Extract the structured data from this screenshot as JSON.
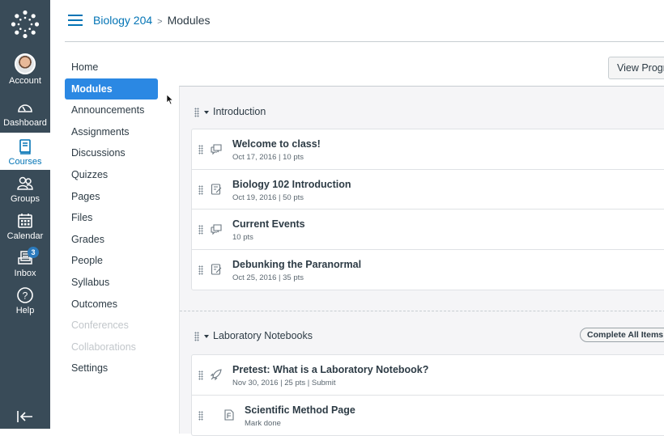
{
  "global_nav": {
    "items": [
      {
        "label": "Account",
        "icon": "avatar"
      },
      {
        "label": "Dashboard",
        "icon": "dashboard-icon"
      },
      {
        "label": "Courses",
        "icon": "courses-icon",
        "active": true
      },
      {
        "label": "Groups",
        "icon": "groups-icon"
      },
      {
        "label": "Calendar",
        "icon": "calendar-icon"
      },
      {
        "label": "Inbox",
        "icon": "inbox-icon",
        "badge": "3"
      },
      {
        "label": "Help",
        "icon": "help-icon"
      }
    ],
    "colors": {
      "background": "#394b58",
      "active_text": "#0374b5",
      "badge": "#2b7abc"
    }
  },
  "header": {
    "course": "Biology 204",
    "separator": ">",
    "page": "Modules"
  },
  "course_nav": {
    "items": [
      {
        "label": "Home"
      },
      {
        "label": "Modules",
        "active": true
      },
      {
        "label": "Announcements"
      },
      {
        "label": "Assignments"
      },
      {
        "label": "Discussions"
      },
      {
        "label": "Quizzes"
      },
      {
        "label": "Pages"
      },
      {
        "label": "Files"
      },
      {
        "label": "Grades"
      },
      {
        "label": "People"
      },
      {
        "label": "Syllabus"
      },
      {
        "label": "Outcomes"
      },
      {
        "label": "Conferences",
        "disabled": true
      },
      {
        "label": "Collaborations",
        "disabled": true
      },
      {
        "label": "Settings"
      }
    ],
    "active_color": "#2b88e3"
  },
  "toolbar": {
    "view_progress_label": "View Progress"
  },
  "modules": [
    {
      "title": "Introduction",
      "items": [
        {
          "title": "Welcome to class!",
          "meta": "Oct 17, 2016  |  10 pts",
          "icon": "discussion-icon"
        },
        {
          "title": "Biology 102 Introduction",
          "meta": "Oct 19, 2016  |  50 pts",
          "icon": "assignment-icon"
        },
        {
          "title": "Current Events",
          "meta": "10 pts",
          "icon": "discussion-icon"
        },
        {
          "title": "Debunking the Paranormal",
          "meta": "Oct 25, 2016  |  35 pts",
          "icon": "assignment-icon"
        }
      ]
    },
    {
      "title": "Laboratory Notebooks",
      "complete_all_label": "Complete All Items",
      "items": [
        {
          "title": "Pretest: What is a Laboratory Notebook?",
          "meta": "Nov 30, 2016  |  25 pts  |  Submit",
          "icon": "quiz-icon"
        },
        {
          "title": "Scientific Method Page",
          "meta": "Mark done",
          "icon": "page-icon"
        }
      ]
    }
  ]
}
